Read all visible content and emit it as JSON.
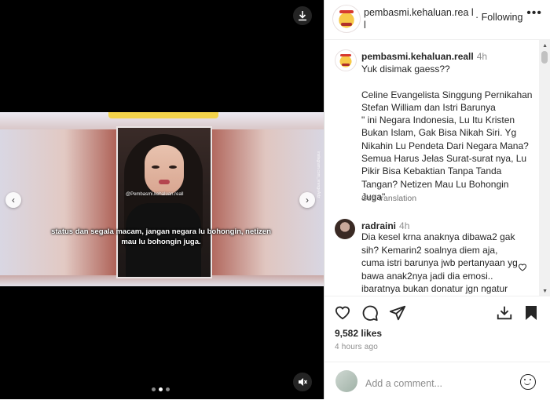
{
  "post": {
    "username": "pembasmi.kehaluan.reall",
    "header_username": "pembasmi.kehaluan.rea ll",
    "follow_label": "Following",
    "menu_icon": "ellipsis-icon"
  },
  "media": {
    "video_handle": "@Pembasmi.kehaluan.reall",
    "side_watermark": "instagram.com_vrengeAdz",
    "caption_overlay": "status dan segala macam, jangan negara lu bohongin, netizen mau lu bohongin juga.",
    "slide_count": 3,
    "active_slide": 2
  },
  "caption": {
    "username": "pembasmi.kehaluan.reall",
    "time": "4h",
    "text": "Yuk disimak gaess??\n\nCeline Evangelista Singgung Pernikahan Stefan William dan Istri Barunya\n\" ini Negara Indonesia, Lu Itu Kristen Bukan Islam, Gak Bisa Nikah Siri. Yg Nikahin Lu Pendeta Dari Negara Mana? Semua Harus Jelas Surat-surat nya, Lu Pikir Bisa Kebaktian Tanpa Tanda Tangan? Netizen Mau Lu Bohongin Juga\"",
    "see_translation": "See translation"
  },
  "comments": [
    {
      "username": "radraini",
      "time": "4h",
      "text": "Dia kesel krna anaknya dibawa2 gak sih? Kemarin2 soalnya diem aja, cuma istri barunya jwb pertanyaan yg bawa anak2nya jadi dia emosi.. ibaratnya bukan donatur jgn ngatur"
    }
  ],
  "actions": {
    "likes": "9,582 likes",
    "time_ago": "4 hours ago",
    "add_comment_placeholder": "Add a comment..."
  }
}
